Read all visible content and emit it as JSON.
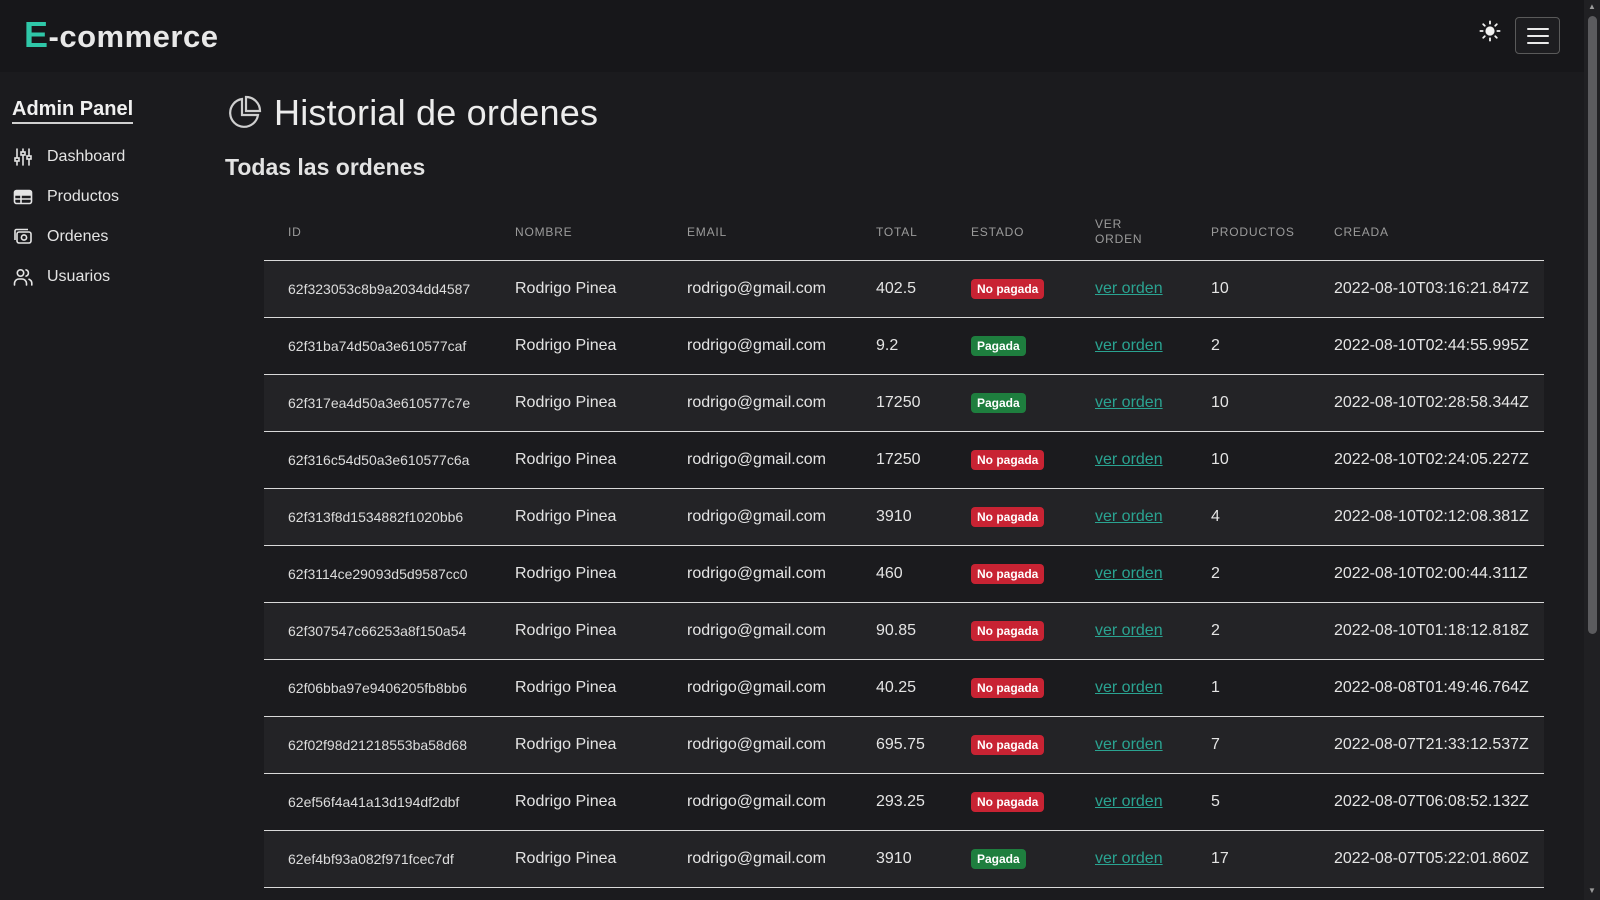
{
  "app": {
    "logo_initial": "E",
    "logo_rest": "-commerce",
    "icons": {
      "theme_toggle": "sun-icon",
      "menu": "hamburger-menu-icon"
    }
  },
  "sidebar": {
    "title": "Admin Panel",
    "items": [
      {
        "label": "Dashboard",
        "icon": "sliders-icon"
      },
      {
        "label": "Productos",
        "icon": "table-icon"
      },
      {
        "label": "Ordenes",
        "icon": "orders-icon"
      },
      {
        "label": "Usuarios",
        "icon": "users-icon"
      }
    ]
  },
  "main": {
    "title": "Historial de ordenes",
    "title_icon": "pie-chart-icon",
    "section_title": "Todas las ordenes",
    "columns": [
      "ID",
      "NOMBRE",
      "EMAIL",
      "TOTAL",
      "ESTADO",
      "VER ORDEN",
      "PRODUCTOS",
      "CREADA"
    ],
    "colors": {
      "accent": "#2fc7a8",
      "link": "#2aa391",
      "unpaid": "#c82333",
      "paid": "#1e7e3e"
    },
    "rows": [
      {
        "id": "62f323053c8b9a2034dd4587",
        "name": "Rodrigo Pinea",
        "email": "rodrigo@gmail.com",
        "total": "402.5",
        "status": "No pagada",
        "paid": false,
        "link": "ver orden",
        "products": "10",
        "created": "2022-08-10T03:16:21.847Z"
      },
      {
        "id": "62f31ba74d50a3e610577caf",
        "name": "Rodrigo Pinea",
        "email": "rodrigo@gmail.com",
        "total": "9.2",
        "status": "Pagada",
        "paid": true,
        "link": "ver orden",
        "products": "2",
        "created": "2022-08-10T02:44:55.995Z"
      },
      {
        "id": "62f317ea4d50a3e610577c7e",
        "name": "Rodrigo Pinea",
        "email": "rodrigo@gmail.com",
        "total": "17250",
        "status": "Pagada",
        "paid": true,
        "link": "ver orden",
        "products": "10",
        "created": "2022-08-10T02:28:58.344Z"
      },
      {
        "id": "62f316c54d50a3e610577c6a",
        "name": "Rodrigo Pinea",
        "email": "rodrigo@gmail.com",
        "total": "17250",
        "status": "No pagada",
        "paid": false,
        "link": "ver orden",
        "products": "10",
        "created": "2022-08-10T02:24:05.227Z"
      },
      {
        "id": "62f313f8d1534882f1020bb6",
        "name": "Rodrigo Pinea",
        "email": "rodrigo@gmail.com",
        "total": "3910",
        "status": "No pagada",
        "paid": false,
        "link": "ver orden",
        "products": "4",
        "created": "2022-08-10T02:12:08.381Z"
      },
      {
        "id": "62f3114ce29093d5d9587cc0",
        "name": "Rodrigo Pinea",
        "email": "rodrigo@gmail.com",
        "total": "460",
        "status": "No pagada",
        "paid": false,
        "link": "ver orden",
        "products": "2",
        "created": "2022-08-10T02:00:44.311Z"
      },
      {
        "id": "62f307547c66253a8f150a54",
        "name": "Rodrigo Pinea",
        "email": "rodrigo@gmail.com",
        "total": "90.85",
        "status": "No pagada",
        "paid": false,
        "link": "ver orden",
        "products": "2",
        "created": "2022-08-10T01:18:12.818Z"
      },
      {
        "id": "62f06bba97e9406205fb8bb6",
        "name": "Rodrigo Pinea",
        "email": "rodrigo@gmail.com",
        "total": "40.25",
        "status": "No pagada",
        "paid": false,
        "link": "ver orden",
        "products": "1",
        "created": "2022-08-08T01:49:46.764Z"
      },
      {
        "id": "62f02f98d21218553ba58d68",
        "name": "Rodrigo Pinea",
        "email": "rodrigo@gmail.com",
        "total": "695.75",
        "status": "No pagada",
        "paid": false,
        "link": "ver orden",
        "products": "7",
        "created": "2022-08-07T21:33:12.537Z"
      },
      {
        "id": "62ef56f4a41a13d194df2dbf",
        "name": "Rodrigo Pinea",
        "email": "rodrigo@gmail.com",
        "total": "293.25",
        "status": "No pagada",
        "paid": false,
        "link": "ver orden",
        "products": "5",
        "created": "2022-08-07T06:08:52.132Z"
      },
      {
        "id": "62ef4bf93a082f971fcec7df",
        "name": "Rodrigo Pinea",
        "email": "rodrigo@gmail.com",
        "total": "3910",
        "status": "Pagada",
        "paid": true,
        "link": "ver orden",
        "products": "17",
        "created": "2022-08-07T05:22:01.860Z"
      }
    ]
  }
}
